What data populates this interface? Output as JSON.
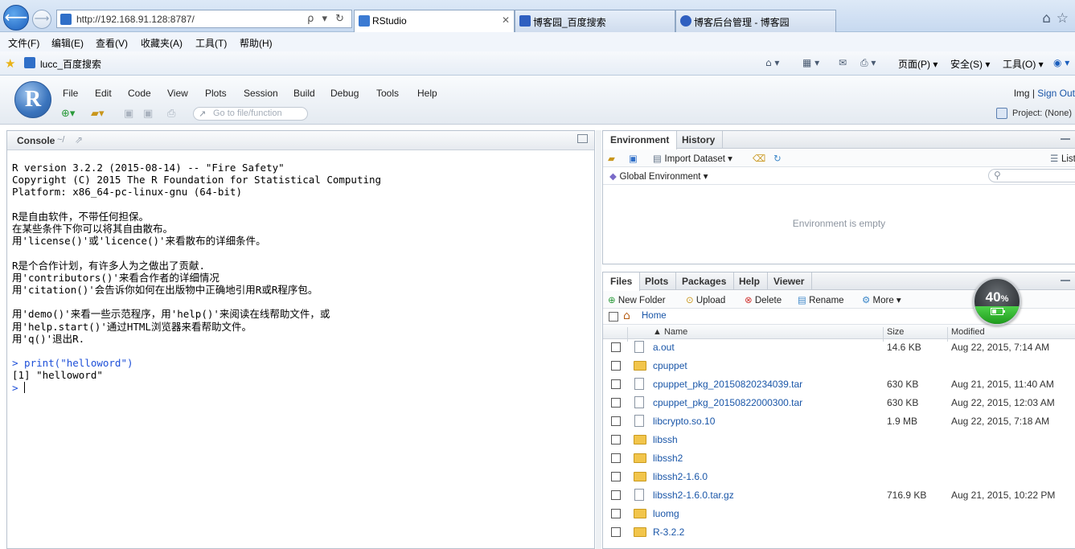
{
  "browser": {
    "address": "http://192.168.91.128:8787/",
    "address_tools": "ρ ▾ ↻",
    "back_glyph": "⟵",
    "forward_glyph": "⟶",
    "tabs": [
      {
        "label": "RStudio",
        "active": true
      },
      {
        "label": "博客园_百度搜索",
        "active": false
      },
      {
        "label": "博客后台管理 - 博客园",
        "active": false
      }
    ],
    "tab_close": "✕",
    "menu": [
      "文件(F)",
      "编辑(E)",
      "查看(V)",
      "收藏夹(A)",
      "工具(T)",
      "帮助(H)"
    ],
    "favorite_item": "lucc_百度搜索",
    "command_bar": {
      "home_glyph": "⌂ ▾",
      "feeds_glyph": "▦ ▾",
      "mail_glyph": "✉",
      "print_glyph": "⎙ ▾",
      "page": "页面(P) ▾",
      "safety": "安全(S) ▾",
      "tools": "工具(O) ▾",
      "help": "◉ ▾"
    }
  },
  "rstudio": {
    "logo_letter": "R",
    "menu": [
      "File",
      "Edit",
      "Code",
      "View",
      "Plots",
      "Session",
      "Build",
      "Debug",
      "Tools",
      "Help"
    ],
    "user": "lmg",
    "user_separator": " | ",
    "signout": "Sign Out",
    "goto_placeholder": "Go to file/function",
    "project": "Project: (None)",
    "console": {
      "title": "Console",
      "path": "~/",
      "lines": [
        {
          "text": "R version 3.2.2 (2015-08-14) -- \"Fire Safety\"",
          "type": "out"
        },
        {
          "text": "Copyright (C) 2015 The R Foundation for Statistical Computing",
          "type": "out"
        },
        {
          "text": "Platform: x86_64-pc-linux-gnu (64-bit)",
          "type": "out"
        },
        {
          "text": "",
          "type": "blank"
        },
        {
          "text": "R是自由软件，不带任何担保。",
          "type": "out"
        },
        {
          "text": "在某些条件下你可以将其自由散布。",
          "type": "out"
        },
        {
          "text": "用'license()'或'licence()'来看散布的详细条件。",
          "type": "out"
        },
        {
          "text": "",
          "type": "blank"
        },
        {
          "text": "R是个合作计划，有许多人为之做出了贡献.",
          "type": "out"
        },
        {
          "text": "用'contributors()'来看合作者的详细情况",
          "type": "out"
        },
        {
          "text": "用'citation()'会告诉你如何在出版物中正确地引用R或R程序包。",
          "type": "out"
        },
        {
          "text": "",
          "type": "blank"
        },
        {
          "text": "用'demo()'来看一些示范程序，用'help()'来阅读在线帮助文件，或",
          "type": "out"
        },
        {
          "text": "用'help.start()'通过HTML浏览器来看帮助文件。",
          "type": "out"
        },
        {
          "text": "用'q()'退出R.",
          "type": "out"
        },
        {
          "text": "",
          "type": "blank"
        },
        {
          "text": "> print(\"helloword\")",
          "type": "cmd"
        },
        {
          "text": "[1] \"helloword\"",
          "type": "out"
        }
      ],
      "prompt": "> "
    },
    "environment": {
      "tabs": [
        "Environment",
        "History"
      ],
      "import_dataset": "Import Dataset ▾",
      "scope": "Global Environment ▾",
      "empty_message": "Environment is empty",
      "list_label": "List"
    },
    "files": {
      "tabs": [
        "Files",
        "Plots",
        "Packages",
        "Help",
        "Viewer"
      ],
      "toolbar": [
        "New Folder",
        "Upload",
        "Delete",
        "Rename",
        "More ▾"
      ],
      "path": "Home",
      "columns": {
        "name": "▲ Name",
        "size": "Size",
        "modified": "Modified"
      },
      "rows": [
        {
          "type": "file",
          "name": "a.out",
          "size": "14.6 KB",
          "modified": "Aug 22, 2015, 7:14 AM"
        },
        {
          "type": "folder",
          "name": "cpuppet",
          "size": "",
          "modified": ""
        },
        {
          "type": "file",
          "name": "cpuppet_pkg_20150820234039.tar",
          "size": "630 KB",
          "modified": "Aug 21, 2015, 11:40 AM"
        },
        {
          "type": "file",
          "name": "cpuppet_pkg_20150822000300.tar",
          "size": "630 KB",
          "modified": "Aug 22, 2015, 12:03 AM"
        },
        {
          "type": "file",
          "name": "libcrypto.so.10",
          "size": "1.9 MB",
          "modified": "Aug 22, 2015, 7:18 AM"
        },
        {
          "type": "folder",
          "name": "libssh",
          "size": "",
          "modified": ""
        },
        {
          "type": "folder",
          "name": "libssh2",
          "size": "",
          "modified": ""
        },
        {
          "type": "folder",
          "name": "libssh2-1.6.0",
          "size": "",
          "modified": ""
        },
        {
          "type": "file",
          "name": "libssh2-1.6.0.tar.gz",
          "size": "716.9 KB",
          "modified": "Aug 21, 2015, 10:22 PM"
        },
        {
          "type": "folder",
          "name": "luomg",
          "size": "",
          "modified": ""
        },
        {
          "type": "folder",
          "name": "R-3.2.2",
          "size": "",
          "modified": ""
        }
      ]
    }
  },
  "battery_widget": {
    "percent": 40,
    "label": "40",
    "unit": "%"
  },
  "colors": {
    "link": "#1a56a8",
    "console_command": "#1d4fd8",
    "ie_accent": "#1c5fbd"
  }
}
